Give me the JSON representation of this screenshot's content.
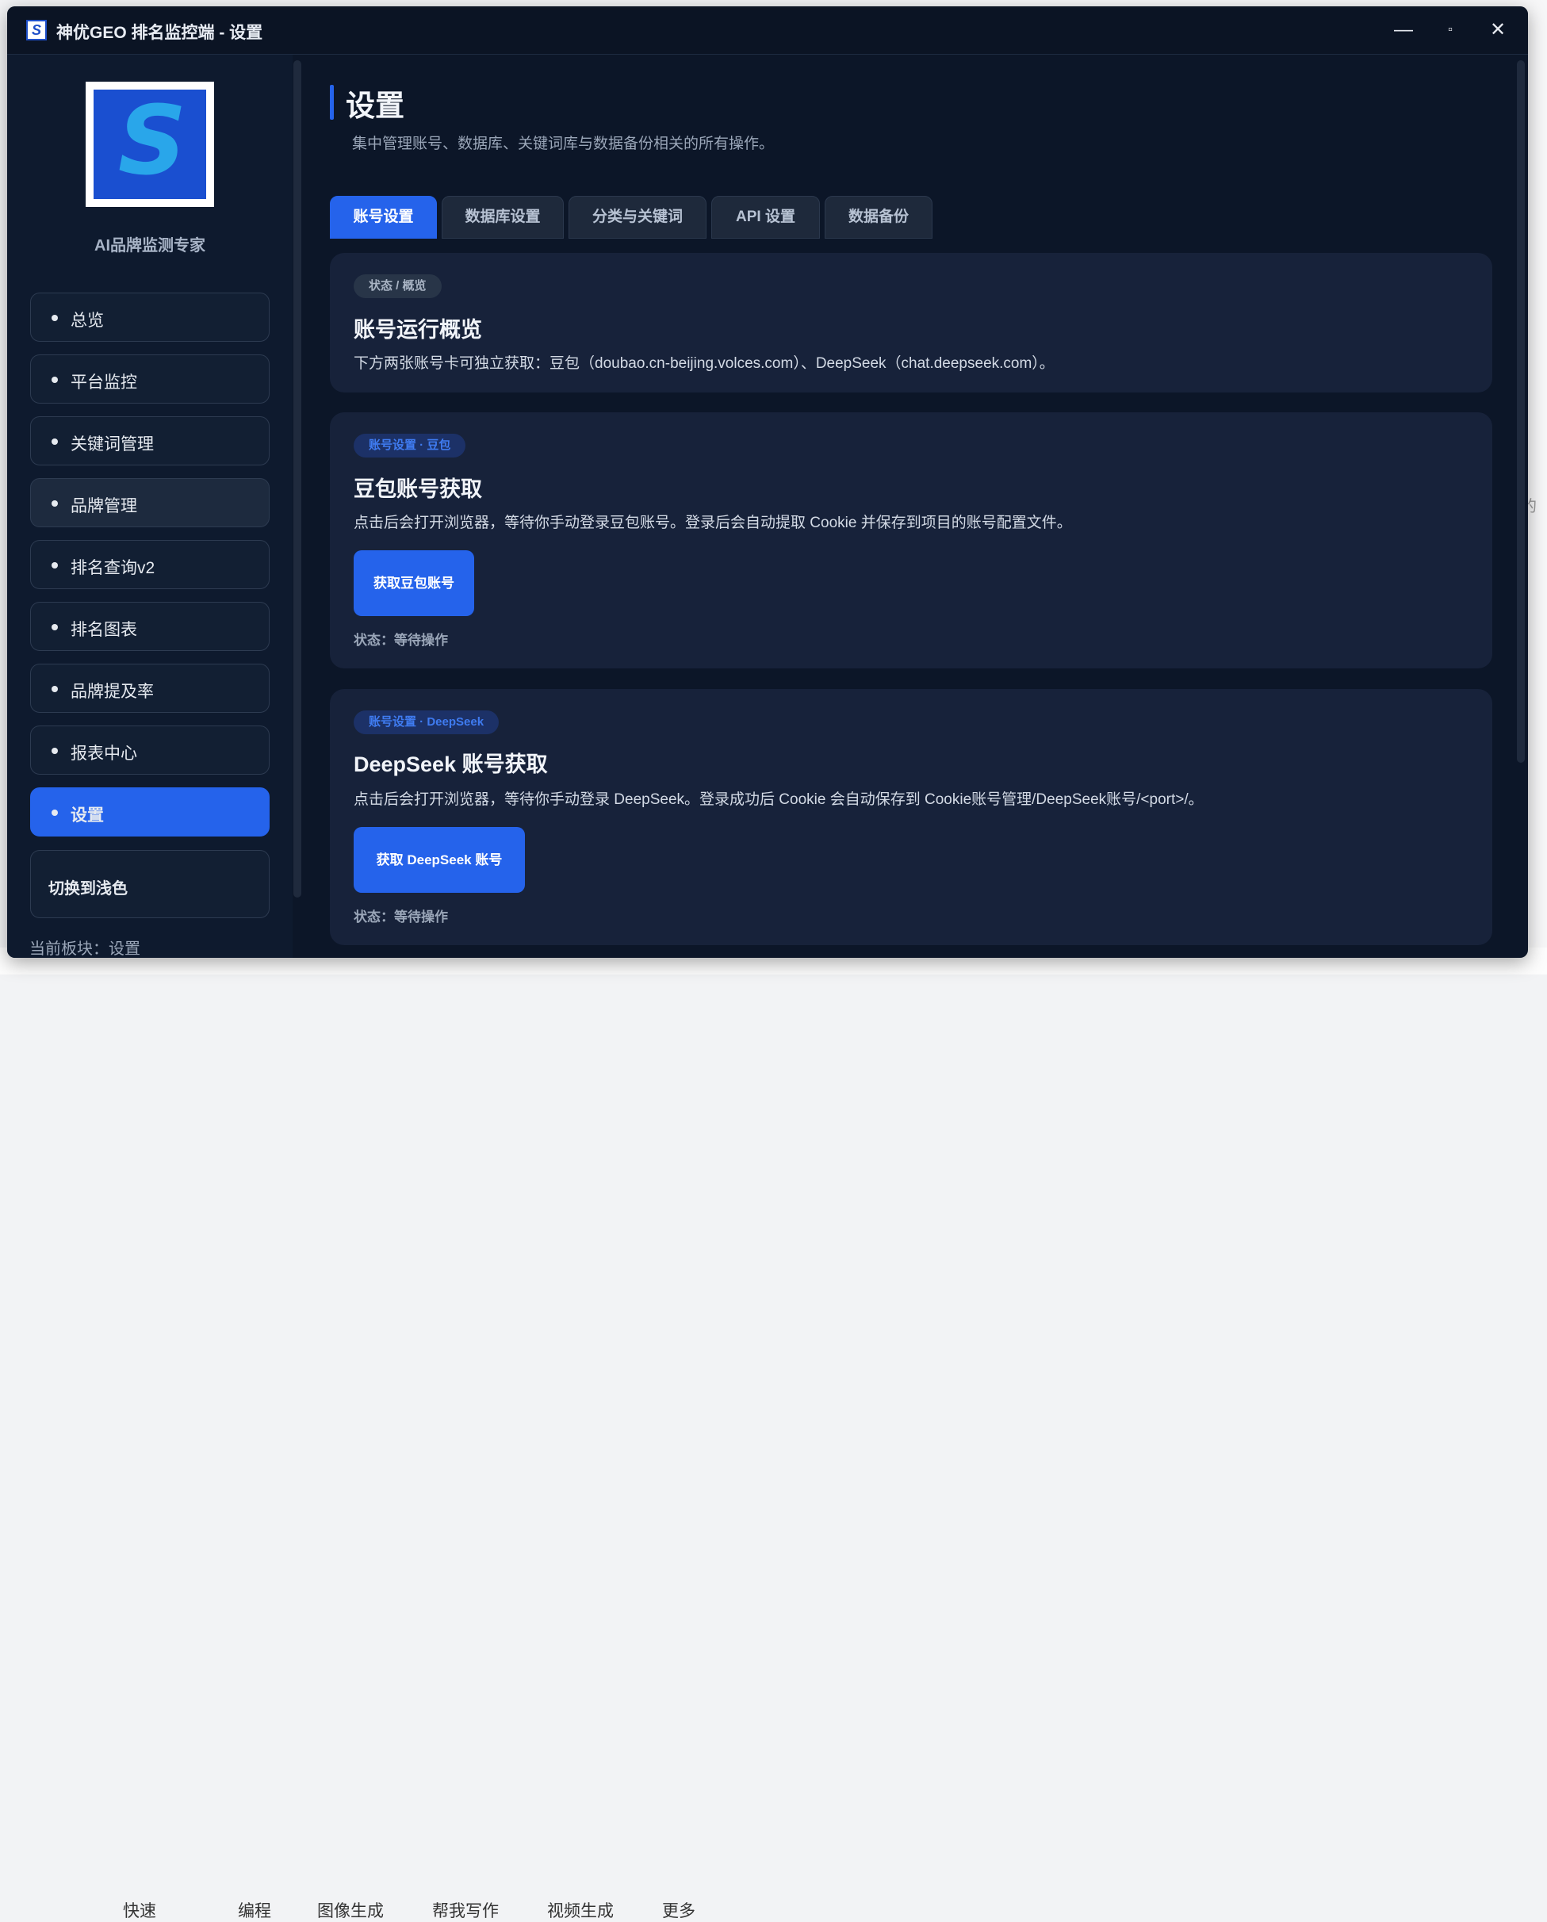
{
  "window": {
    "title": "神优GEO 排名监控端 - 设置",
    "controls": {
      "minimize": "—",
      "maximize": "▫",
      "close": "✕"
    }
  },
  "sidebar": {
    "logo_glyph": "S",
    "subtitle": "AI品牌监测专家",
    "items": [
      {
        "label": "总览"
      },
      {
        "label": "平台监控"
      },
      {
        "label": "关键词管理"
      },
      {
        "label": "品牌管理"
      },
      {
        "label": "排名查询v2"
      },
      {
        "label": "排名图表"
      },
      {
        "label": "品牌提及率"
      },
      {
        "label": "报表中心"
      },
      {
        "label": "设置"
      }
    ],
    "active_index": 8,
    "theme_toggle": "切换到浅色",
    "current_block": "当前板块：设置"
  },
  "page": {
    "title": "设置",
    "subtitle": "集中管理账号、数据库、关键词库与数据备份相关的所有操作。"
  },
  "tabs": [
    {
      "label": "账号设置",
      "active": true
    },
    {
      "label": "数据库设置",
      "active": false
    },
    {
      "label": "分类与关键词",
      "active": false
    },
    {
      "label": "API 设置",
      "active": false
    },
    {
      "label": "数据备份",
      "active": false
    }
  ],
  "cards": {
    "overview": {
      "tag": "状态 / 概览",
      "title": "账号运行概览",
      "desc": "下方两张账号卡可独立获取：豆包（doubao.cn-beijing.volces.com）、DeepSeek（chat.deepseek.com）。"
    },
    "doubao": {
      "tag": "账号设置 · 豆包",
      "title": "豆包账号获取",
      "desc": "点击后会打开浏览器，等待你手动登录豆包账号。登录后会自动提取 Cookie 并保存到项目的账号配置文件。",
      "button": "获取豆包账号",
      "status": "状态：等待操作"
    },
    "deepseek": {
      "tag": "账号设置 · DeepSeek",
      "title": "DeepSeek 账号获取",
      "desc": "点击后会打开浏览器，等待你手动登录 DeepSeek。登录成功后 Cookie 会自动保存到 Cookie账号管理/DeepSeek账号/<port>/。",
      "button": "获取 DeepSeek 账号",
      "status": "状态：等待操作"
    }
  },
  "background_taskbar": {
    "items": [
      "快速",
      "编程",
      "图像生成",
      "帮我写作",
      "视频生成",
      "更多"
    ],
    "edge_text": "的"
  },
  "colors": {
    "accent": "#2563eb",
    "window_bg": "#0c1628",
    "card_bg": "#17223a"
  }
}
